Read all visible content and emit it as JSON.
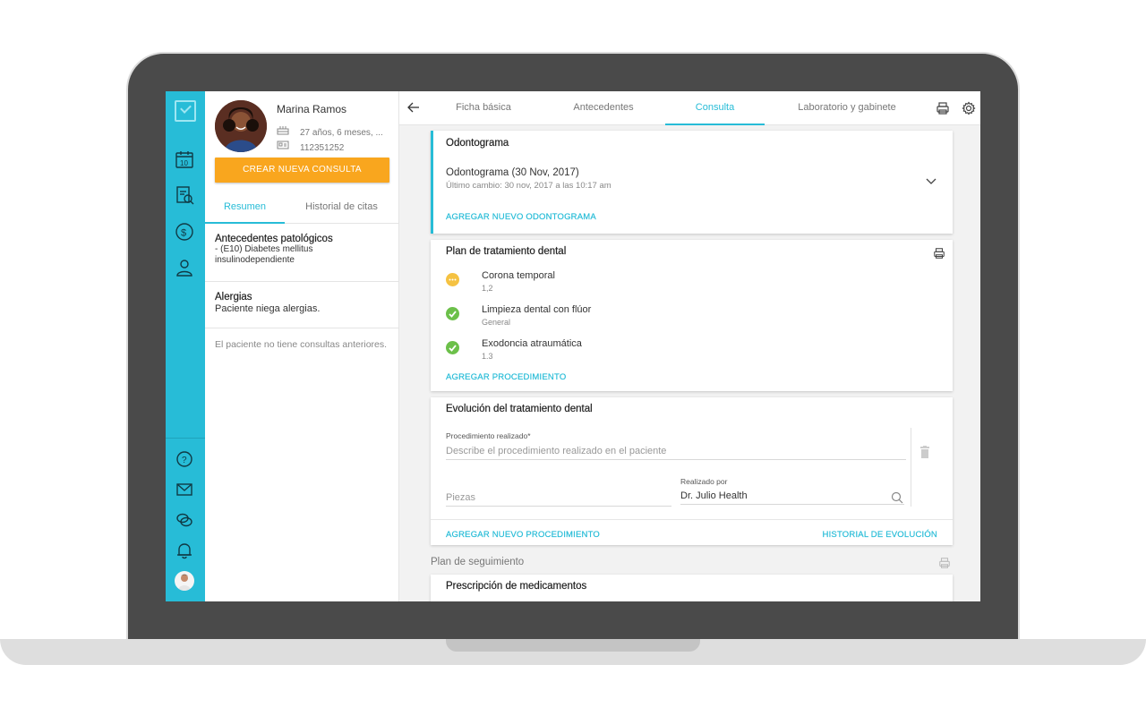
{
  "patient": {
    "name": "Marina Ramos",
    "age": "27 años, 6 meses, ...",
    "id_number": "112351252",
    "new_consult_label": "CREAR NUEVA CONSULTA",
    "tabs": [
      {
        "label": "Resumen",
        "active": true
      },
      {
        "label": "Historial de citas",
        "active": false
      }
    ],
    "summary": {
      "pathology_title": "Antecedentes patológicos",
      "pathology_text": "- (E10) Diabetes mellitus insulinodependiente",
      "allergies_title": "Alergias",
      "allergies_text": "Paciente niega alergias.",
      "no_consults": "El paciente no tiene consultas anteriores."
    }
  },
  "tabs": [
    {
      "label": "Ficha básica",
      "active": false
    },
    {
      "label": "Antecedentes",
      "active": false
    },
    {
      "label": "Consulta",
      "active": true
    },
    {
      "label": "Laboratorio y gabinete",
      "active": false
    }
  ],
  "odontogram": {
    "title": "Odontograma",
    "entry_title": "Odontograma (30 Nov, 2017)",
    "entry_sub": "Último cambio: 30 nov, 2017 a las 10:17 am",
    "add_label": "AGREGAR NUEVO ODONTOGRAMA"
  },
  "plan": {
    "title": "Plan de tratamiento dental",
    "procedures": [
      {
        "name": "Corona temporal",
        "code": "1,2",
        "status": "pending"
      },
      {
        "name": "Limpieza dental con flúor",
        "code": "General",
        "status": "done"
      },
      {
        "name": "Exodoncia atraumática",
        "code": "1.3",
        "status": "done"
      }
    ],
    "add_label": "AGREGAR PROCEDIMIENTO"
  },
  "evolution": {
    "title": "Evolución del tratamiento dental",
    "procedure_label": "Procedimiento realizado*",
    "procedure_placeholder": "Describe el procedimiento realizado en el paciente",
    "pieces_placeholder": "Piezas",
    "performed_by_label": "Realizado por",
    "performed_by_value": "Dr. Julio Health",
    "add_label": "AGREGAR NUEVO PROCEDIMIENTO",
    "history_label": "HISTORIAL DE EVOLUCIÓN"
  },
  "followup": {
    "title": "Plan de seguimiento"
  },
  "prescription": {
    "title": "Prescripción de medicamentos"
  },
  "colors": {
    "accent": "#27bcd7",
    "button": "#f9a61e",
    "success": "#6cc04a",
    "pending": "#f5c242"
  },
  "icons": {
    "rail": [
      "logo-icon",
      "calendar-icon",
      "records-icon",
      "dollar-icon",
      "user-icon",
      "help-icon",
      "mail-icon",
      "chat-icon",
      "bell-icon"
    ],
    "toolbar": [
      "print-icon",
      "gear-icon"
    ]
  }
}
